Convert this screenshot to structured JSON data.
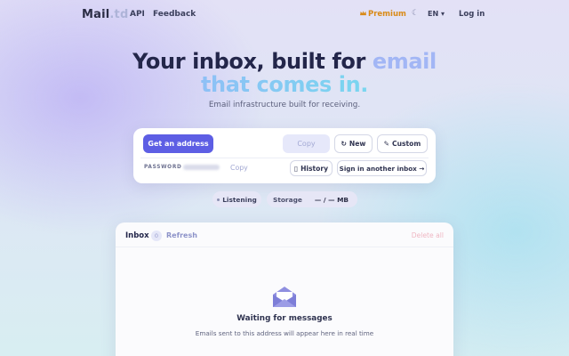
{
  "header": {
    "logo_main": "Mail",
    "logo_tld": ".td",
    "nav": {
      "api": "API",
      "feedback": "Feedback"
    },
    "premium_icon": "crown-icon",
    "premium_label": "Premium",
    "theme_icon": "moon-icon",
    "theme_glyph": "☾",
    "language": "EN ▾",
    "login": "Log in"
  },
  "hero": {
    "line1_pre": "Your inbox, built for ",
    "line1_accent": "email",
    "line2": "that comes in.",
    "subtitle": "Email infrastructure built for receiving."
  },
  "address_card": {
    "get_address": "Get an address",
    "copy": "Copy",
    "new_icon": "refresh-icon",
    "new_glyph": "↻",
    "new_label": "New",
    "custom_icon": "pencil-icon",
    "custom_glyph": "✎",
    "custom_label": "Custom",
    "password_label": "PASSWORD",
    "password_copy": "Copy",
    "history_icon": "clipboard-icon",
    "history_glyph": "▯",
    "history_label": "History",
    "sign_in_label": "Sign in another inbox →"
  },
  "status": {
    "listening_label": "Listening",
    "storage_label": "Storage",
    "storage_value": "— / — MB"
  },
  "inbox": {
    "title": "Inbox",
    "count": "0",
    "refresh": "Refresh",
    "delete_all": "Delete all",
    "empty_icon": "envelope-open-icon",
    "empty_title": "Waiting for messages",
    "empty_subtitle": "Emails sent to this address will appear here in real time"
  },
  "colors": {
    "brand": "#5d5ee4",
    "premium": "#d98a16",
    "hero_accent": "#a2b6f5",
    "hero_gradient_start": "#8ec0f6",
    "hero_gradient_end": "#79d6ef",
    "danger_muted": "#efb7c3"
  }
}
